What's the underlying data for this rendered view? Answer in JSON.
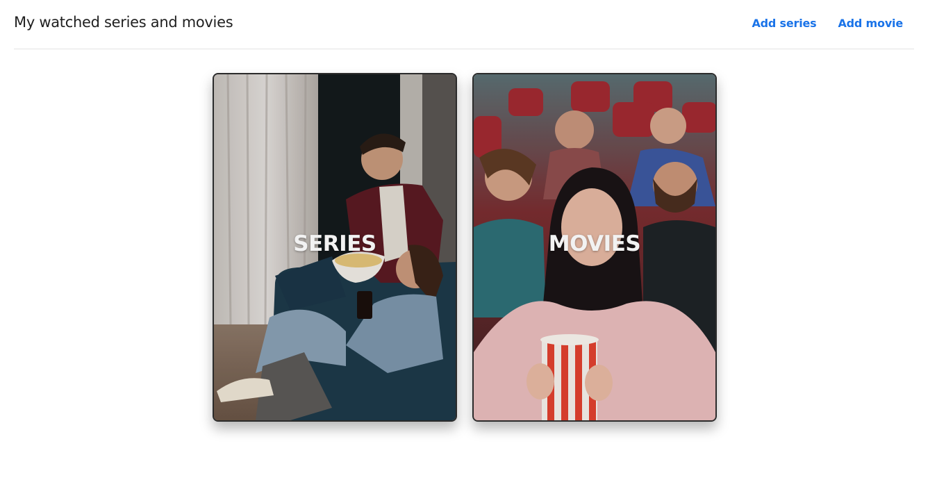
{
  "header": {
    "title": "My watched series and movies",
    "nav": {
      "add_series": "Add series",
      "add_movie": "Add movie"
    },
    "link_color": "#1a73e8"
  },
  "cards": [
    {
      "label": "SERIES",
      "image": "couple-watching-tv-on-sofa-photo"
    },
    {
      "label": "MOVIES",
      "image": "audience-in-cinema-with-popcorn-photo"
    }
  ]
}
